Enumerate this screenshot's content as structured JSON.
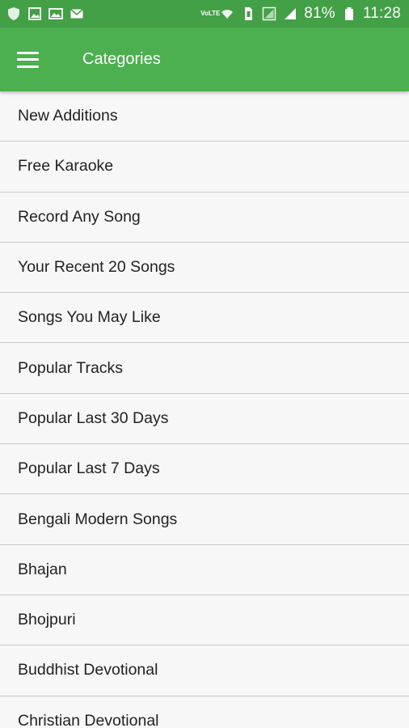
{
  "status_bar": {
    "battery_percent": "81%",
    "time": "11:28",
    "network_label": "VoLTE",
    "left_icons": [
      "shield-icon",
      "gallery-icon",
      "gallery-icon",
      "mail-icon"
    ],
    "right_icons": [
      "volte-icon",
      "wifi-icon",
      "sim-icon",
      "signal-icon",
      "signal-icon",
      "battery-icon"
    ]
  },
  "app_bar": {
    "title": "Categories",
    "menu_icon": "hamburger-menu-icon",
    "color": "#4caf50"
  },
  "categories": [
    {
      "label": "New Additions"
    },
    {
      "label": "Free Karaoke"
    },
    {
      "label": "Record Any Song"
    },
    {
      "label": "Your Recent 20 Songs"
    },
    {
      "label": "Songs You May Like"
    },
    {
      "label": "Popular Tracks"
    },
    {
      "label": "Popular Last 30 Days"
    },
    {
      "label": "Popular Last 7 Days"
    },
    {
      "label": "Bengali Modern Songs"
    },
    {
      "label": "Bhajan"
    },
    {
      "label": "Bhojpuri"
    },
    {
      "label": "Buddhist Devotional"
    },
    {
      "label": "Christian Devotional"
    }
  ]
}
